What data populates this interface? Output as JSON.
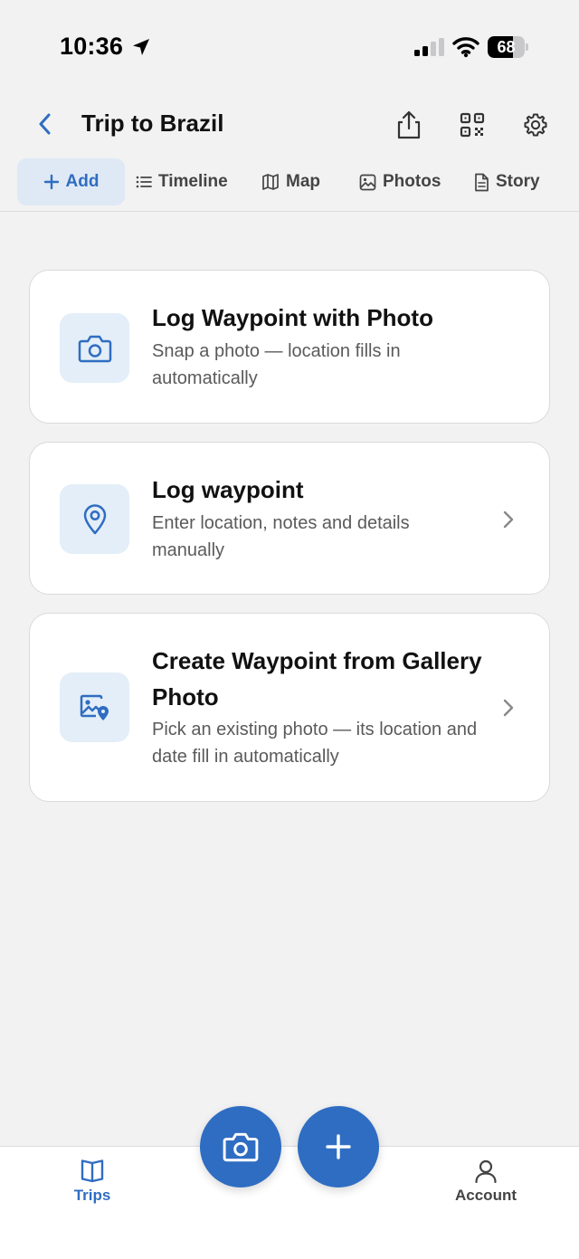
{
  "status_bar": {
    "time": "10:36",
    "battery": "68",
    "battery_level": 0.68
  },
  "header": {
    "title": "Trip to Brazil"
  },
  "tabs": [
    {
      "label": "Add",
      "icon": "plus-icon",
      "active": true
    },
    {
      "label": "Timeline",
      "icon": "list-icon"
    },
    {
      "label": "Map",
      "icon": "map-icon"
    },
    {
      "label": "Photos",
      "icon": "image-icon"
    },
    {
      "label": "Story",
      "icon": "document-icon"
    }
  ],
  "cards": [
    {
      "title": "Log Waypoint with Photo",
      "desc": "Snap a photo — location fills in automatically",
      "icon": "camera-icon"
    },
    {
      "title": "Log waypoint",
      "desc": "Enter location, notes and details manually",
      "icon": "map-pin-icon"
    },
    {
      "title": "Create Waypoint from Gallery Photo",
      "desc": "Pick an existing photo — its location and date fill in automatically",
      "icon": "gallery-location-icon"
    }
  ],
  "bottom_nav": {
    "trips": "Trips",
    "account": "Account"
  },
  "colors": {
    "accent": "#2f6dc2",
    "background": "#f2f2f3",
    "icon_tile": "#e3eef8",
    "active_tab_bg": "#dfe9f5"
  }
}
